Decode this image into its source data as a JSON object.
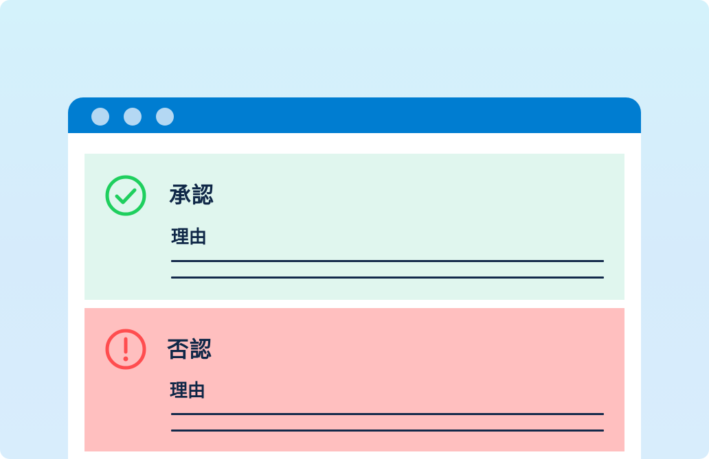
{
  "colors": {
    "titlebar": "#007dd1",
    "approve_panel": "#e0f6ee",
    "reject_panel": "#ffbfbf",
    "approve_icon": "#1fcf5e",
    "reject_icon": "#ff4d4f",
    "text": "#0f2747"
  },
  "window": {
    "controls": [
      "dot",
      "dot",
      "dot"
    ]
  },
  "approve": {
    "icon": "check-circle-icon",
    "title": "承認",
    "reason_label": "理由"
  },
  "reject": {
    "icon": "exclamation-circle-icon",
    "title": "否認",
    "reason_label": "理由"
  }
}
